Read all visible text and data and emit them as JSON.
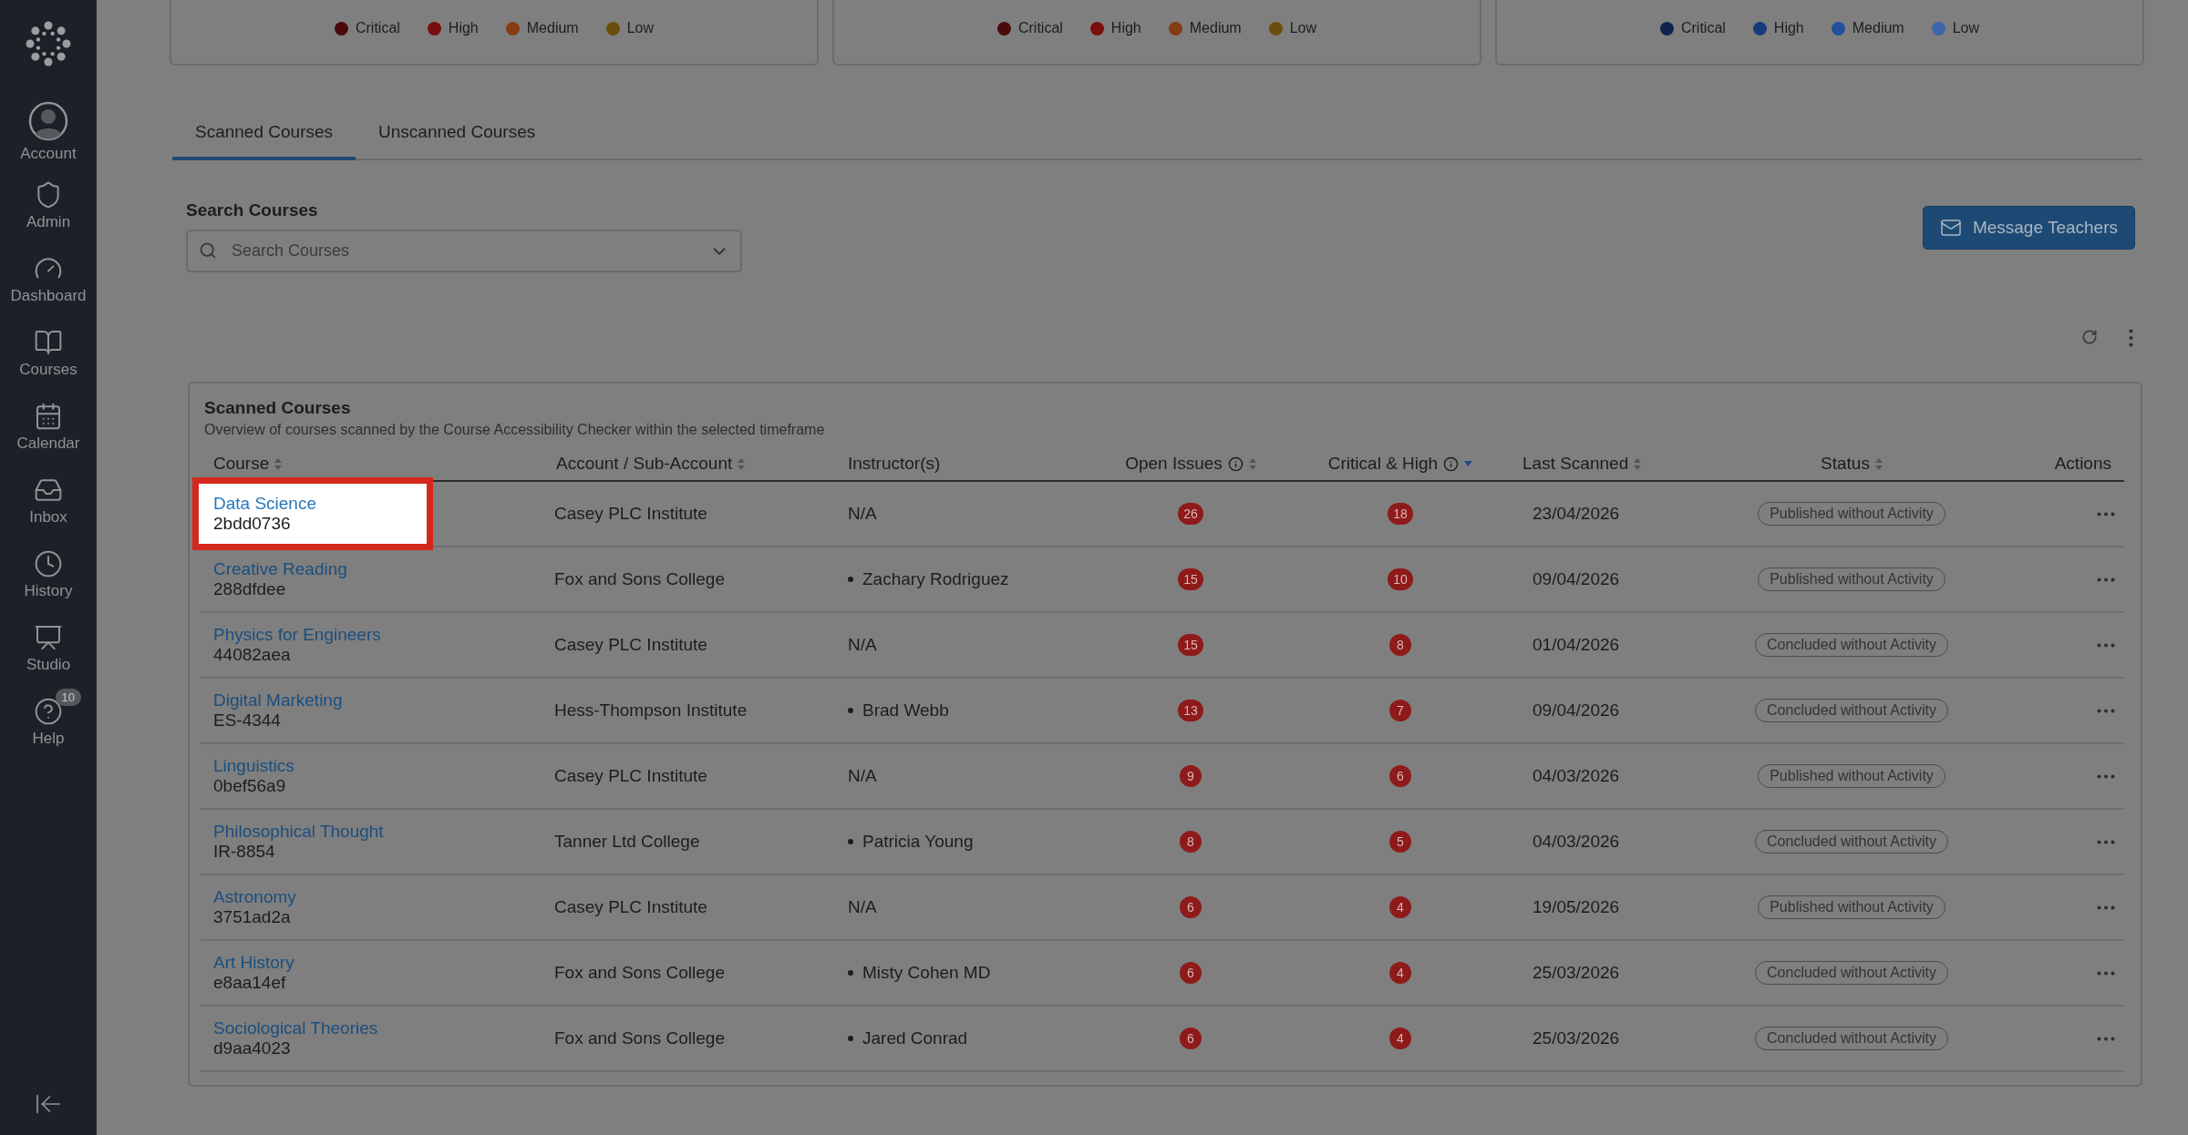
{
  "sidebar": {
    "items": [
      {
        "label": "Account"
      },
      {
        "label": "Admin"
      },
      {
        "label": "Dashboard"
      },
      {
        "label": "Courses"
      },
      {
        "label": "Calendar"
      },
      {
        "label": "Inbox"
      },
      {
        "label": "History"
      },
      {
        "label": "Studio"
      },
      {
        "label": "Help",
        "badge": "10"
      }
    ]
  },
  "legends": [
    {
      "items": [
        {
          "label": "Critical",
          "color": "#4a0a0c"
        },
        {
          "label": "High",
          "color": "#780e0e"
        },
        {
          "label": "Medium",
          "color": "#853c12"
        },
        {
          "label": "Low",
          "color": "#6a4e0c"
        }
      ]
    },
    {
      "items": [
        {
          "label": "Critical",
          "color": "#4a0a0c"
        },
        {
          "label": "High",
          "color": "#780e0e"
        },
        {
          "label": "Medium",
          "color": "#853c12"
        },
        {
          "label": "Low",
          "color": "#6a4e0c"
        }
      ]
    },
    {
      "items": [
        {
          "label": "Critical",
          "color": "#0e2350"
        },
        {
          "label": "High",
          "color": "#173a7a"
        },
        {
          "label": "Medium",
          "color": "#22509a"
        },
        {
          "label": "Low",
          "color": "#3b66a8"
        }
      ]
    }
  ],
  "tabs": [
    {
      "label": "Scanned Courses",
      "selected": true
    },
    {
      "label": "Unscanned Courses",
      "selected": false
    }
  ],
  "search": {
    "label": "Search Courses",
    "placeholder": "Search Courses"
  },
  "message_button": "Message Teachers",
  "table": {
    "title": "Scanned Courses",
    "subtitle": "Overview of courses scanned by the Course Accessibility Checker within the selected timeframe",
    "columns": [
      {
        "label": "Course",
        "sortable": true,
        "sorted": false,
        "info": false
      },
      {
        "label": "Account / Sub-Account",
        "sortable": true,
        "sorted": false,
        "info": false
      },
      {
        "label": "Instructor(s)",
        "sortable": false,
        "info": false
      },
      {
        "label": "Open Issues",
        "sortable": true,
        "sorted": false,
        "info": true
      },
      {
        "label": "Critical & High",
        "sortable": true,
        "sorted": true,
        "info": true
      },
      {
        "label": "Last Scanned",
        "sortable": true,
        "sorted": false,
        "info": false
      },
      {
        "label": "Status",
        "sortable": true,
        "sorted": false,
        "info": false
      },
      {
        "label": "Actions",
        "sortable": false,
        "info": false
      }
    ],
    "rows": [
      {
        "course": "Data Science",
        "code": "2bdd0736",
        "highlighted": true,
        "account": "Casey PLC Institute",
        "instructor": {
          "text": "N/A",
          "bulleted": false
        },
        "open_issues": "26",
        "critical_high": "18",
        "last_scanned": "23/04/2026",
        "status": "Published without Activity"
      },
      {
        "course": "Creative Reading",
        "code": "288dfdee",
        "highlighted": false,
        "account": "Fox and Sons College",
        "instructor": {
          "text": "Zachary Rodriguez",
          "bulleted": true
        },
        "open_issues": "15",
        "critical_high": "10",
        "last_scanned": "09/04/2026",
        "status": "Published without Activity"
      },
      {
        "course": "Physics for Engineers",
        "code": "44082aea",
        "highlighted": false,
        "account": "Casey PLC Institute",
        "instructor": {
          "text": "N/A",
          "bulleted": false
        },
        "open_issues": "15",
        "critical_high": "8",
        "last_scanned": "01/04/2026",
        "status": "Concluded without Activity"
      },
      {
        "course": "Digital Marketing",
        "code": "ES-4344",
        "highlighted": false,
        "account": "Hess-Thompson Institute",
        "instructor": {
          "text": "Brad Webb",
          "bulleted": true
        },
        "open_issues": "13",
        "critical_high": "7",
        "last_scanned": "09/04/2026",
        "status": "Concluded without Activity"
      },
      {
        "course": "Linguistics",
        "code": "0bef56a9",
        "highlighted": false,
        "account": "Casey PLC Institute",
        "instructor": {
          "text": "N/A",
          "bulleted": false
        },
        "open_issues": "9",
        "critical_high": "6",
        "last_scanned": "04/03/2026",
        "status": "Published without Activity"
      },
      {
        "course": "Philosophical Thought",
        "code": "IR-8854",
        "highlighted": false,
        "account": "Tanner Ltd College",
        "instructor": {
          "text": "Patricia Young",
          "bulleted": true
        },
        "open_issues": "8",
        "critical_high": "5",
        "last_scanned": "04/03/2026",
        "status": "Concluded without Activity"
      },
      {
        "course": "Astronomy",
        "code": "3751ad2a",
        "highlighted": false,
        "account": "Casey PLC Institute",
        "instructor": {
          "text": "N/A",
          "bulleted": false
        },
        "open_issues": "6",
        "critical_high": "4",
        "last_scanned": "19/05/2026",
        "status": "Published without Activity"
      },
      {
        "course": "Art History",
        "code": "e8aa14ef",
        "highlighted": false,
        "account": "Fox and Sons College",
        "instructor": {
          "text": "Misty Cohen MD",
          "bulleted": true
        },
        "open_issues": "6",
        "critical_high": "4",
        "last_scanned": "25/03/2026",
        "status": "Concluded without Activity"
      },
      {
        "course": "Sociological Theories",
        "code": "d9aa4023",
        "highlighted": false,
        "account": "Fox and Sons College",
        "instructor": {
          "text": "Jared Conrad",
          "bulleted": true
        },
        "open_issues": "6",
        "critical_high": "4",
        "last_scanned": "25/03/2026",
        "status": "Concluded without Activity"
      }
    ]
  }
}
